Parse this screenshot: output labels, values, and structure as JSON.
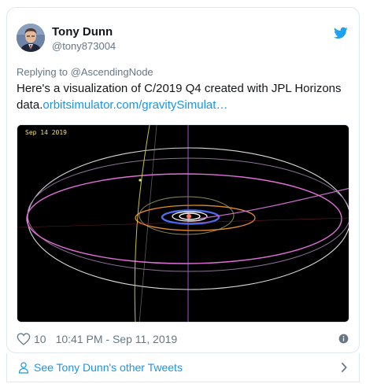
{
  "author": {
    "name": "Tony Dunn",
    "handle": "@tony873004"
  },
  "reply_to": {
    "prefix": "Replying to",
    "handle": "@AscendingNode"
  },
  "tweet": {
    "text": "Here's a visualization of C/2019 Q4 created with JPL Horizons data.",
    "link_text": "orbitsimulator.com/gravitySimulat…"
  },
  "media": {
    "date_label": "Sep 14 2019"
  },
  "footer": {
    "like_count": "10",
    "timestamp": "10:41 PM - Sep 11, 2019"
  },
  "more_tweets": {
    "label": "See Tony Dunn's other Tweets"
  },
  "icons": {
    "brand": "twitter-bird-icon",
    "like": "heart-icon",
    "info": "info-icon",
    "person": "person-icon",
    "chevron": "chevron-right-icon"
  },
  "colors": {
    "brand_blue": "#1da1f2",
    "link": "#1b95e0",
    "muted": "#657786",
    "text": "#14171a"
  }
}
